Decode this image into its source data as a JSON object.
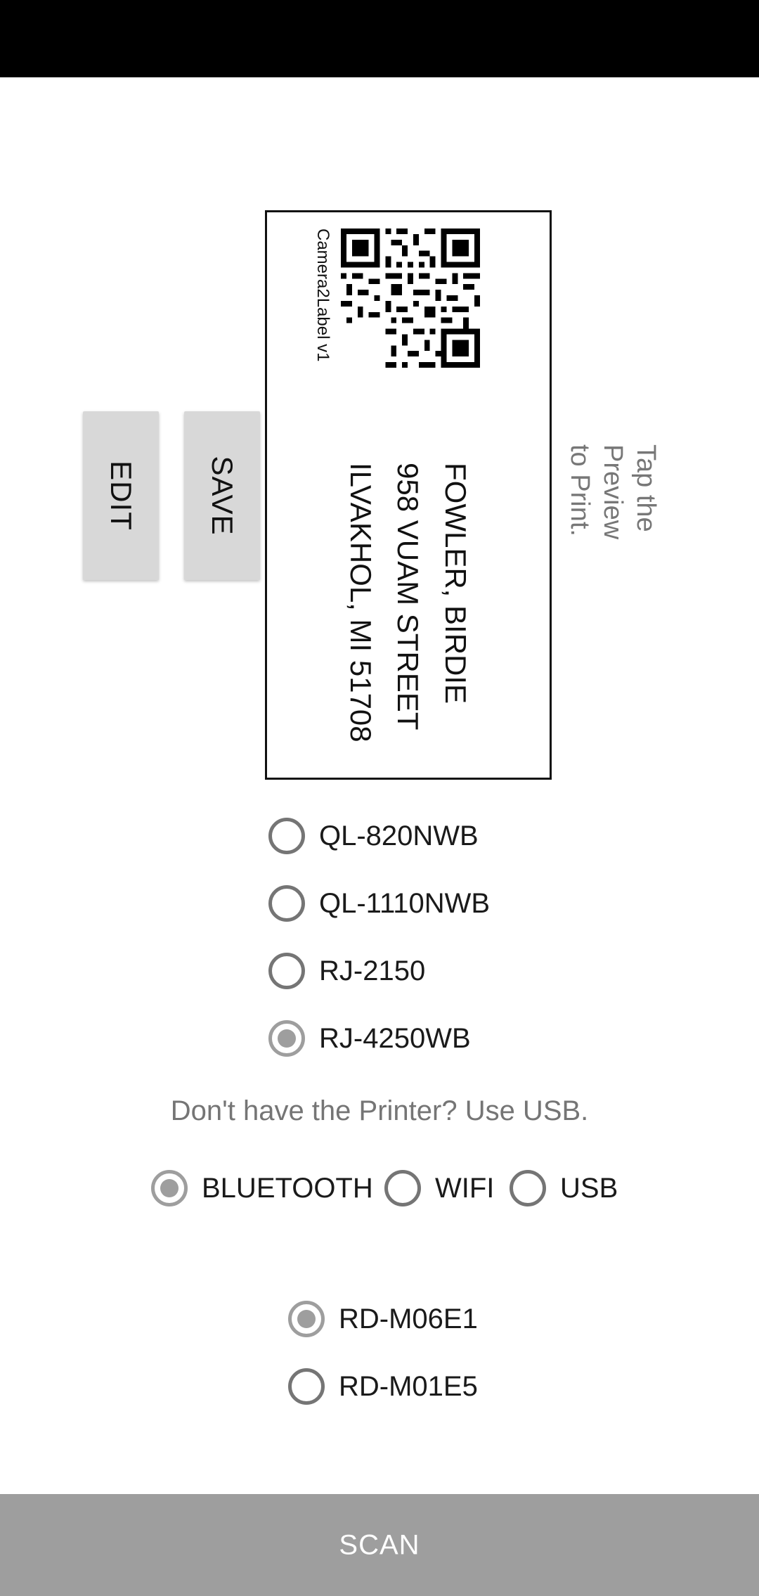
{
  "actions": {
    "edit_label": "EDIT",
    "save_label": "SAVE",
    "scan_label": "SCAN"
  },
  "label": {
    "qr_caption": "Camera2Label v1",
    "lines": [
      "FOWLER, BIRDIE",
      "958 VUAM STREET",
      "ILVAKHOL, MI 51708"
    ]
  },
  "hint": {
    "lines": [
      "Tap the",
      "Preview",
      "to Print."
    ]
  },
  "printers": [
    {
      "label": "QL-820NWB",
      "checked": false
    },
    {
      "label": "QL-1110NWB",
      "checked": false
    },
    {
      "label": "RJ-2150",
      "checked": false
    },
    {
      "label": "RJ-4250WB",
      "checked": true
    }
  ],
  "usb_note": "Don't have the Printer? Use USB.",
  "connections": [
    {
      "label": "BLUETOOTH",
      "checked": true
    },
    {
      "label": "WIFI",
      "checked": false
    },
    {
      "label": "USB",
      "checked": false
    }
  ],
  "devices": [
    {
      "label": "RD-M06E1",
      "checked": true
    },
    {
      "label": "RD-M01E5",
      "checked": false
    }
  ]
}
